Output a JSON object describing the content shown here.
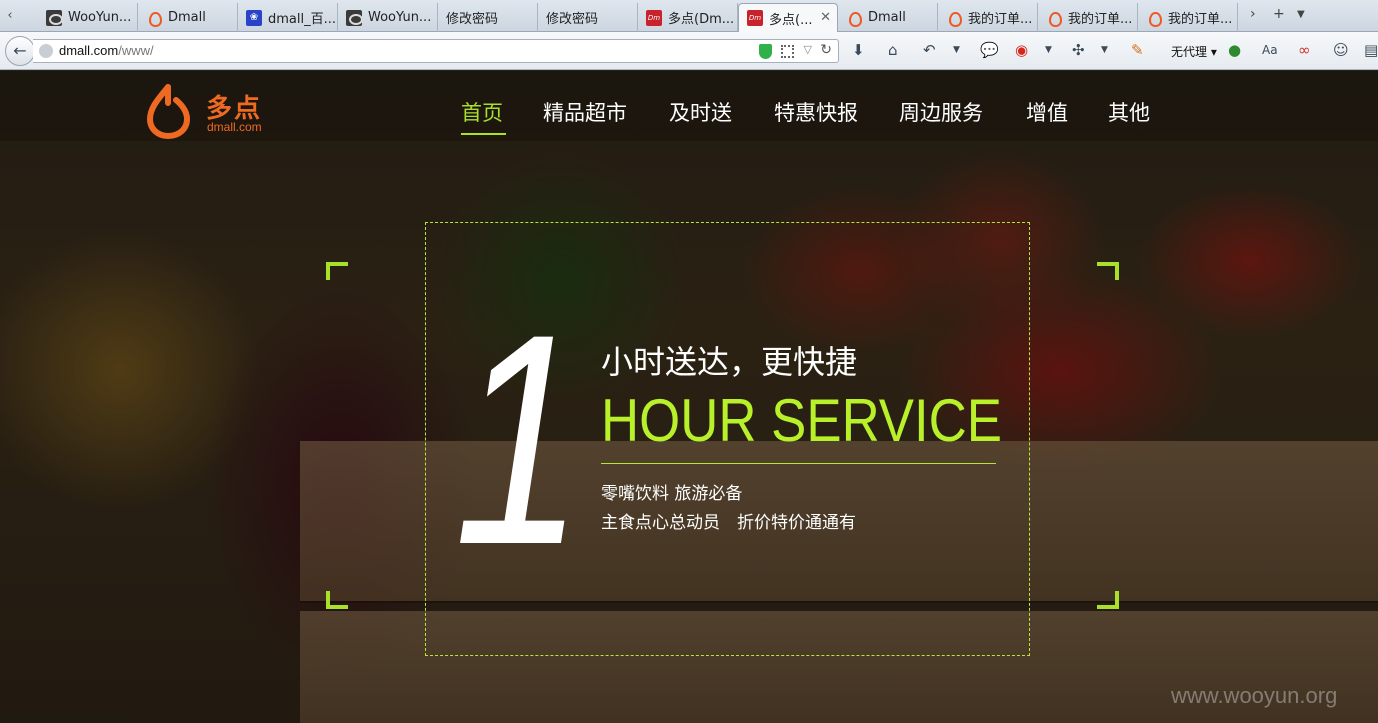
{
  "browser": {
    "tabs": [
      {
        "label": "WooYun...",
        "favicon": "wooyun-icon"
      },
      {
        "label": "Dmall",
        "favicon": "dmall-icon"
      },
      {
        "label": "dmall_百...",
        "favicon": "baidu-paw-icon"
      },
      {
        "label": "WooYun...",
        "favicon": "wooyun-icon"
      },
      {
        "label": "修改密码",
        "favicon": ""
      },
      {
        "label": "修改密码",
        "favicon": ""
      },
      {
        "label": "多点(Dm...",
        "favicon": "dmall-red-icon"
      },
      {
        "label": "多点(...",
        "favicon": "dmall-red-icon",
        "active": true
      },
      {
        "label": "Dmall",
        "favicon": "dmall-icon"
      },
      {
        "label": "我的订单...",
        "favicon": "dmall-icon"
      },
      {
        "label": "我的订单...",
        "favicon": "dmall-icon"
      },
      {
        "label": "我的订单...",
        "favicon": "dmall-icon"
      }
    ],
    "url_host": "dmall.com",
    "url_path": "/www/",
    "proxy_label": "无代理"
  },
  "site": {
    "logo_cn": "多点",
    "logo_en": "dmall.com",
    "nav": [
      "首页",
      "精品超市",
      "及时送",
      "特惠快报",
      "周边服务",
      "增值",
      "其他"
    ],
    "active_nav": "首页",
    "hero": {
      "big_number": "1",
      "tagline": "小时送达，更快捷",
      "service": "HOUR SERVICE",
      "line1": "零嘴饮料 旅游必备",
      "line2": "主食点心总动员　折价特价通通有"
    },
    "accent_color": "#a8e02a",
    "brand_color": "#ee6a22"
  },
  "watermark": "www.wooyun.org"
}
